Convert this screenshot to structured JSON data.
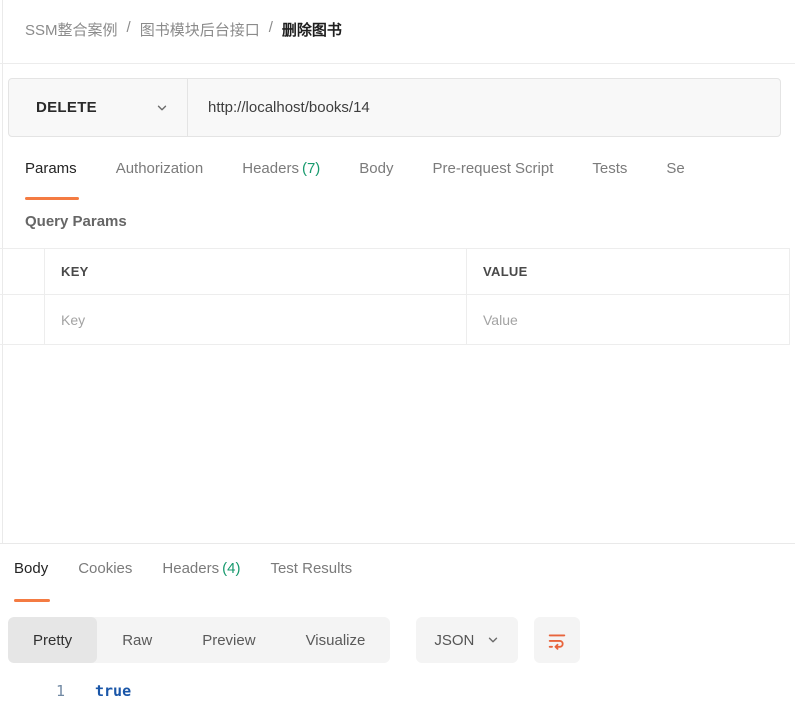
{
  "breadcrumb": {
    "separator": "/",
    "segments": [
      "SSM整合案例",
      "图书模块后台接口",
      "删除图书"
    ]
  },
  "request": {
    "method": "DELETE",
    "url": "http://localhost/books/14",
    "tabs": {
      "params": "Params",
      "authorization": "Authorization",
      "headers": "Headers",
      "headers_count": "(7)",
      "body": "Body",
      "prerequest": "Pre-request Script",
      "tests": "Tests",
      "settings_clipped": "Se"
    },
    "query_params": {
      "title": "Query Params",
      "key_header": "KEY",
      "value_header": "VALUE",
      "key_placeholder": "Key",
      "value_placeholder": "Value"
    }
  },
  "response": {
    "tabs": {
      "body": "Body",
      "cookies": "Cookies",
      "headers": "Headers",
      "headers_count": "(4)",
      "test_results": "Test Results"
    },
    "view_modes": {
      "pretty": "Pretty",
      "raw": "Raw",
      "preview": "Preview",
      "visualize": "Visualize"
    },
    "active_view_mode": "Pretty",
    "format_select": "JSON",
    "body": {
      "line_number": "1",
      "line_content": "true"
    }
  },
  "colors": {
    "accent_orange": "#f47b42",
    "count_green": "#189a6e",
    "code_blue": "#1a56a8"
  }
}
